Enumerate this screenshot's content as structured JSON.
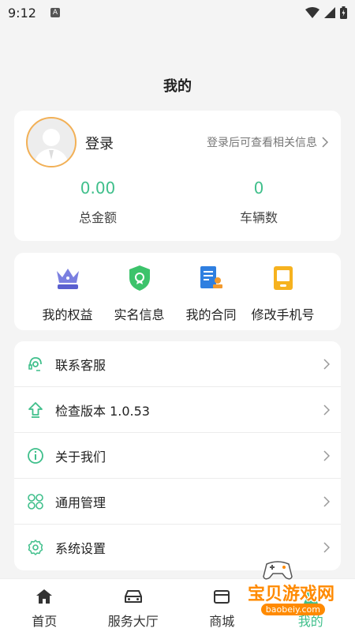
{
  "status_bar": {
    "time": "9:12",
    "a_badge": "A"
  },
  "header": {
    "title": "我的"
  },
  "profile": {
    "login_label": "登录",
    "login_hint": "登录后可查看相关信息",
    "total_amount_value": "0.00",
    "total_amount_label": "总金额",
    "vehicles_value": "0",
    "vehicles_label": "车辆数"
  },
  "quick_actions": [
    {
      "label": "我的权益",
      "icon": "crown-icon"
    },
    {
      "label": "实名信息",
      "icon": "shield-icon"
    },
    {
      "label": "我的合同",
      "icon": "contract-icon"
    },
    {
      "label": "修改手机号",
      "icon": "phone-edit-icon"
    }
  ],
  "menu": [
    {
      "label": "联系客服",
      "icon": "headset-icon"
    },
    {
      "label": "检查版本 1.0.53",
      "icon": "upload-arrow-icon"
    },
    {
      "label": "关于我们",
      "icon": "info-icon"
    },
    {
      "label": "通用管理",
      "icon": "grid-icon"
    },
    {
      "label": "系统设置",
      "icon": "gear-icon"
    }
  ],
  "bottom_nav": [
    {
      "label": "首页",
      "icon": "home-icon"
    },
    {
      "label": "服务大厅",
      "icon": "car-icon"
    },
    {
      "label": "商城",
      "icon": "shop-icon"
    },
    {
      "label": "我的",
      "icon": "profile-icon"
    }
  ],
  "watermark": {
    "text": "宝贝游戏网",
    "url": "baobeiy.com"
  },
  "colors": {
    "accent": "#3fbf8b",
    "avatar_border": "#f2b056",
    "background": "#f4f4f4"
  }
}
